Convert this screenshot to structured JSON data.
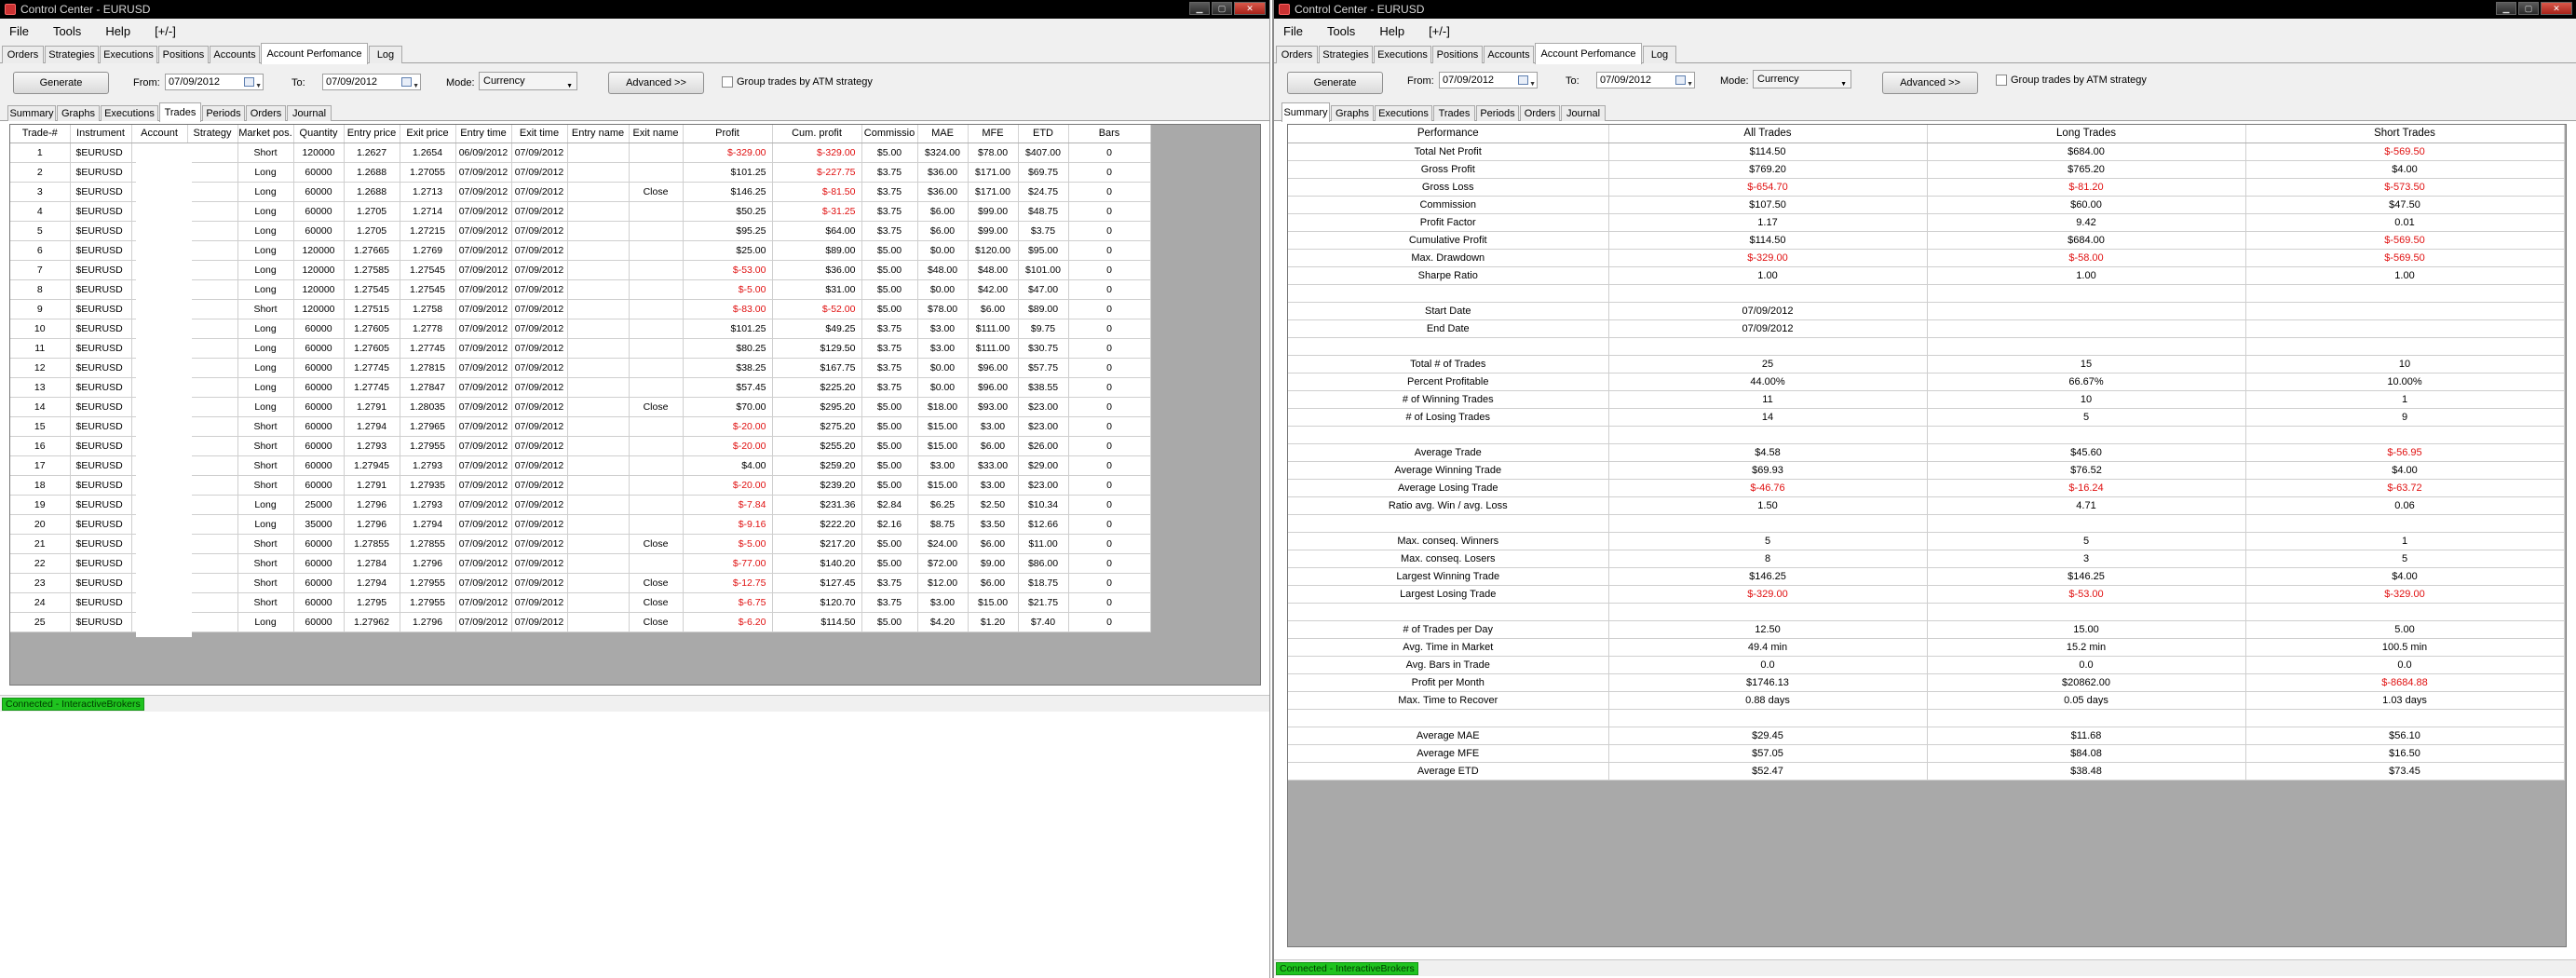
{
  "left": {
    "title": "Control Center - EURUSD",
    "menu": [
      "File",
      "Tools",
      "Help",
      "[+/-]"
    ],
    "tabs": [
      "Orders",
      "Strategies",
      "Executions",
      "Positions",
      "Accounts",
      "Account Perfomance",
      "Log"
    ],
    "generate_label": "Generate",
    "from_label": "From:",
    "from_date": "07/09/2012",
    "to_label": "To:",
    "to_date": "07/09/2012",
    "mode_label": "Mode:",
    "mode_value": "Currency",
    "advanced_label": "Advanced >>",
    "group_label": "Group trades by ATM strategy",
    "subtabs": [
      "Summary",
      "Graphs",
      "Executions",
      "Trades",
      "Periods",
      "Orders",
      "Journal"
    ],
    "columns": [
      "Trade-#",
      "Instrument",
      "Account",
      "Strategy",
      "Market pos.",
      "Quantity",
      "Entry price",
      "Exit price",
      "Entry time",
      "Exit time",
      "Entry name",
      "Exit name",
      "Profit",
      "Cum. profit",
      "Commissio",
      "MAE",
      "MFE",
      "ETD",
      "Bars"
    ],
    "rows": [
      [
        "1",
        "$EURUSD",
        "",
        "",
        "Short",
        "120000",
        "1.2627",
        "1.2654",
        "06/09/2012",
        "07/09/2012",
        "",
        "",
        "$-329.00",
        "$-329.00",
        "$5.00",
        "$324.00",
        "$78.00",
        "$407.00",
        "0"
      ],
      [
        "2",
        "$EURUSD",
        "",
        "",
        "Long",
        "60000",
        "1.2688",
        "1.27055",
        "07/09/2012",
        "07/09/2012",
        "",
        "",
        "$101.25",
        "$-227.75",
        "$3.75",
        "$36.00",
        "$171.00",
        "$69.75",
        "0"
      ],
      [
        "3",
        "$EURUSD",
        "",
        "",
        "Long",
        "60000",
        "1.2688",
        "1.2713",
        "07/09/2012",
        "07/09/2012",
        "",
        "Close",
        "$146.25",
        "$-81.50",
        "$3.75",
        "$36.00",
        "$171.00",
        "$24.75",
        "0"
      ],
      [
        "4",
        "$EURUSD",
        "",
        "",
        "Long",
        "60000",
        "1.2705",
        "1.2714",
        "07/09/2012",
        "07/09/2012",
        "",
        "",
        "$50.25",
        "$-31.25",
        "$3.75",
        "$6.00",
        "$99.00",
        "$48.75",
        "0"
      ],
      [
        "5",
        "$EURUSD",
        "",
        "",
        "Long",
        "60000",
        "1.2705",
        "1.27215",
        "07/09/2012",
        "07/09/2012",
        "",
        "",
        "$95.25",
        "$64.00",
        "$3.75",
        "$6.00",
        "$99.00",
        "$3.75",
        "0"
      ],
      [
        "6",
        "$EURUSD",
        "",
        "",
        "Long",
        "120000",
        "1.27665",
        "1.2769",
        "07/09/2012",
        "07/09/2012",
        "",
        "",
        "$25.00",
        "$89.00",
        "$5.00",
        "$0.00",
        "$120.00",
        "$95.00",
        "0"
      ],
      [
        "7",
        "$EURUSD",
        "",
        "",
        "Long",
        "120000",
        "1.27585",
        "1.27545",
        "07/09/2012",
        "07/09/2012",
        "",
        "",
        "$-53.00",
        "$36.00",
        "$5.00",
        "$48.00",
        "$48.00",
        "$101.00",
        "0"
      ],
      [
        "8",
        "$EURUSD",
        "",
        "",
        "Long",
        "120000",
        "1.27545",
        "1.27545",
        "07/09/2012",
        "07/09/2012",
        "",
        "",
        "$-5.00",
        "$31.00",
        "$5.00",
        "$0.00",
        "$42.00",
        "$47.00",
        "0"
      ],
      [
        "9",
        "$EURUSD",
        "",
        "",
        "Short",
        "120000",
        "1.27515",
        "1.2758",
        "07/09/2012",
        "07/09/2012",
        "",
        "",
        "$-83.00",
        "$-52.00",
        "$5.00",
        "$78.00",
        "$6.00",
        "$89.00",
        "0"
      ],
      [
        "10",
        "$EURUSD",
        "",
        "",
        "Long",
        "60000",
        "1.27605",
        "1.2778",
        "07/09/2012",
        "07/09/2012",
        "",
        "",
        "$101.25",
        "$49.25",
        "$3.75",
        "$3.00",
        "$111.00",
        "$9.75",
        "0"
      ],
      [
        "11",
        "$EURUSD",
        "",
        "",
        "Long",
        "60000",
        "1.27605",
        "1.27745",
        "07/09/2012",
        "07/09/2012",
        "",
        "",
        "$80.25",
        "$129.50",
        "$3.75",
        "$3.00",
        "$111.00",
        "$30.75",
        "0"
      ],
      [
        "12",
        "$EURUSD",
        "",
        "",
        "Long",
        "60000",
        "1.27745",
        "1.27815",
        "07/09/2012",
        "07/09/2012",
        "",
        "",
        "$38.25",
        "$167.75",
        "$3.75",
        "$0.00",
        "$96.00",
        "$57.75",
        "0"
      ],
      [
        "13",
        "$EURUSD",
        "",
        "",
        "Long",
        "60000",
        "1.27745",
        "1.27847",
        "07/09/2012",
        "07/09/2012",
        "",
        "",
        "$57.45",
        "$225.20",
        "$3.75",
        "$0.00",
        "$96.00",
        "$38.55",
        "0"
      ],
      [
        "14",
        "$EURUSD",
        "",
        "",
        "Long",
        "60000",
        "1.2791",
        "1.28035",
        "07/09/2012",
        "07/09/2012",
        "",
        "Close",
        "$70.00",
        "$295.20",
        "$5.00",
        "$18.00",
        "$93.00",
        "$23.00",
        "0"
      ],
      [
        "15",
        "$EURUSD",
        "",
        "",
        "Short",
        "60000",
        "1.2794",
        "1.27965",
        "07/09/2012",
        "07/09/2012",
        "",
        "",
        "$-20.00",
        "$275.20",
        "$5.00",
        "$15.00",
        "$3.00",
        "$23.00",
        "0"
      ],
      [
        "16",
        "$EURUSD",
        "",
        "",
        "Short",
        "60000",
        "1.2793",
        "1.27955",
        "07/09/2012",
        "07/09/2012",
        "",
        "",
        "$-20.00",
        "$255.20",
        "$5.00",
        "$15.00",
        "$6.00",
        "$26.00",
        "0"
      ],
      [
        "17",
        "$EURUSD",
        "",
        "",
        "Short",
        "60000",
        "1.27945",
        "1.2793",
        "07/09/2012",
        "07/09/2012",
        "",
        "",
        "$4.00",
        "$259.20",
        "$5.00",
        "$3.00",
        "$33.00",
        "$29.00",
        "0"
      ],
      [
        "18",
        "$EURUSD",
        "",
        "",
        "Short",
        "60000",
        "1.2791",
        "1.27935",
        "07/09/2012",
        "07/09/2012",
        "",
        "",
        "$-20.00",
        "$239.20",
        "$5.00",
        "$15.00",
        "$3.00",
        "$23.00",
        "0"
      ],
      [
        "19",
        "$EURUSD",
        "",
        "",
        "Long",
        "25000",
        "1.2796",
        "1.2793",
        "07/09/2012",
        "07/09/2012",
        "",
        "",
        "$-7.84",
        "$231.36",
        "$2.84",
        "$6.25",
        "$2.50",
        "$10.34",
        "0"
      ],
      [
        "20",
        "$EURUSD",
        "",
        "",
        "Long",
        "35000",
        "1.2796",
        "1.2794",
        "07/09/2012",
        "07/09/2012",
        "",
        "",
        "$-9.16",
        "$222.20",
        "$2.16",
        "$8.75",
        "$3.50",
        "$12.66",
        "0"
      ],
      [
        "21",
        "$EURUSD",
        "",
        "",
        "Short",
        "60000",
        "1.27855",
        "1.27855",
        "07/09/2012",
        "07/09/2012",
        "",
        "Close",
        "$-5.00",
        "$217.20",
        "$5.00",
        "$24.00",
        "$6.00",
        "$11.00",
        "0"
      ],
      [
        "22",
        "$EURUSD",
        "",
        "",
        "Short",
        "60000",
        "1.2784",
        "1.2796",
        "07/09/2012",
        "07/09/2012",
        "",
        "",
        "$-77.00",
        "$140.20",
        "$5.00",
        "$72.00",
        "$9.00",
        "$86.00",
        "0"
      ],
      [
        "23",
        "$EURUSD",
        "",
        "",
        "Short",
        "60000",
        "1.2794",
        "1.27955",
        "07/09/2012",
        "07/09/2012",
        "",
        "Close",
        "$-12.75",
        "$127.45",
        "$3.75",
        "$12.00",
        "$6.00",
        "$18.75",
        "0"
      ],
      [
        "24",
        "$EURUSD",
        "",
        "",
        "Short",
        "60000",
        "1.2795",
        "1.27955",
        "07/09/2012",
        "07/09/2012",
        "",
        "Close",
        "$-6.75",
        "$120.70",
        "$3.75",
        "$3.00",
        "$15.00",
        "$21.75",
        "0"
      ],
      [
        "25",
        "$EURUSD",
        "",
        "",
        "Long",
        "60000",
        "1.27962",
        "1.2796",
        "07/09/2012",
        "07/09/2012",
        "",
        "Close",
        "$-6.20",
        "$114.50",
        "$5.00",
        "$4.20",
        "$1.20",
        "$7.40",
        "0"
      ]
    ],
    "status": "Connected - InteractiveBrokers"
  },
  "right": {
    "title": "Control Center - EURUSD",
    "menu": [
      "File",
      "Tools",
      "Help",
      "[+/-]"
    ],
    "tabs": [
      "Orders",
      "Strategies",
      "Executions",
      "Positions",
      "Accounts",
      "Account Perfomance",
      "Log"
    ],
    "generate_label": "Generate",
    "from_label": "From:",
    "from_date": "07/09/2012",
    "to_label": "To:",
    "to_date": "07/09/2012",
    "mode_label": "Mode:",
    "mode_value": "Currency",
    "advanced_label": "Advanced >>",
    "group_label": "Group trades by ATM strategy",
    "subtabs": [
      "Summary",
      "Graphs",
      "Executions",
      "Trades",
      "Periods",
      "Orders",
      "Journal"
    ],
    "columns": [
      "Performance",
      "All Trades",
      "Long Trades",
      "Short Trades"
    ],
    "rows": [
      [
        "Total Net Profit",
        "$114.50",
        "$684.00",
        "$-569.50"
      ],
      [
        "Gross Profit",
        "$769.20",
        "$765.20",
        "$4.00"
      ],
      [
        "Gross Loss",
        "$-654.70",
        "$-81.20",
        "$-573.50"
      ],
      [
        "Commission",
        "$107.50",
        "$60.00",
        "$47.50"
      ],
      [
        "Profit Factor",
        "1.17",
        "9.42",
        "0.01"
      ],
      [
        "Cumulative Profit",
        "$114.50",
        "$684.00",
        "$-569.50"
      ],
      [
        "Max. Drawdown",
        "$-329.00",
        "$-58.00",
        "$-569.50"
      ],
      [
        "Sharpe Ratio",
        "1.00",
        "1.00",
        "1.00"
      ],
      [
        "",
        "",
        "",
        ""
      ],
      [
        "Start Date",
        "07/09/2012",
        "",
        ""
      ],
      [
        "End Date",
        "07/09/2012",
        "",
        ""
      ],
      [
        "",
        "",
        "",
        ""
      ],
      [
        "Total # of Trades",
        "25",
        "15",
        "10"
      ],
      [
        "Percent Profitable",
        "44.00%",
        "66.67%",
        "10.00%"
      ],
      [
        "# of Winning Trades",
        "11",
        "10",
        "1"
      ],
      [
        "# of Losing Trades",
        "14",
        "5",
        "9"
      ],
      [
        "",
        "",
        "",
        ""
      ],
      [
        "Average Trade",
        "$4.58",
        "$45.60",
        "$-56.95"
      ],
      [
        "Average Winning Trade",
        "$69.93",
        "$76.52",
        "$4.00"
      ],
      [
        "Average Losing Trade",
        "$-46.76",
        "$-16.24",
        "$-63.72"
      ],
      [
        "Ratio avg. Win / avg. Loss",
        "1.50",
        "4.71",
        "0.06"
      ],
      [
        "",
        "",
        "",
        ""
      ],
      [
        "Max. conseq. Winners",
        "5",
        "5",
        "1"
      ],
      [
        "Max. conseq. Losers",
        "8",
        "3",
        "5"
      ],
      [
        "Largest Winning Trade",
        "$146.25",
        "$146.25",
        "$4.00"
      ],
      [
        "Largest Losing Trade",
        "$-329.00",
        "$-53.00",
        "$-329.00"
      ],
      [
        "",
        "",
        "",
        ""
      ],
      [
        "# of Trades per Day",
        "12.50",
        "15.00",
        "5.00"
      ],
      [
        "Avg. Time in Market",
        "49.4 min",
        "15.2 min",
        "100.5 min"
      ],
      [
        "Avg. Bars in Trade",
        "0.0",
        "0.0",
        "0.0"
      ],
      [
        "Profit per Month",
        "$1746.13",
        "$20862.00",
        "$-8684.88"
      ],
      [
        "Max. Time to Recover",
        "0.88 days",
        "0.05 days",
        "1.03 days"
      ],
      [
        "",
        "",
        "",
        ""
      ],
      [
        "Average MAE",
        "$29.45",
        "$11.68",
        "$56.10"
      ],
      [
        "Average MFE",
        "$57.05",
        "$84.08",
        "$16.50"
      ],
      [
        "Average ETD",
        "$52.47",
        "$38.48",
        "$73.45"
      ]
    ],
    "status": "Connected - InteractiveBrokers"
  },
  "colors": {
    "negative": "#e01010",
    "status_ok": "#1fc31f",
    "empty_grid": "#a9a9a9"
  }
}
